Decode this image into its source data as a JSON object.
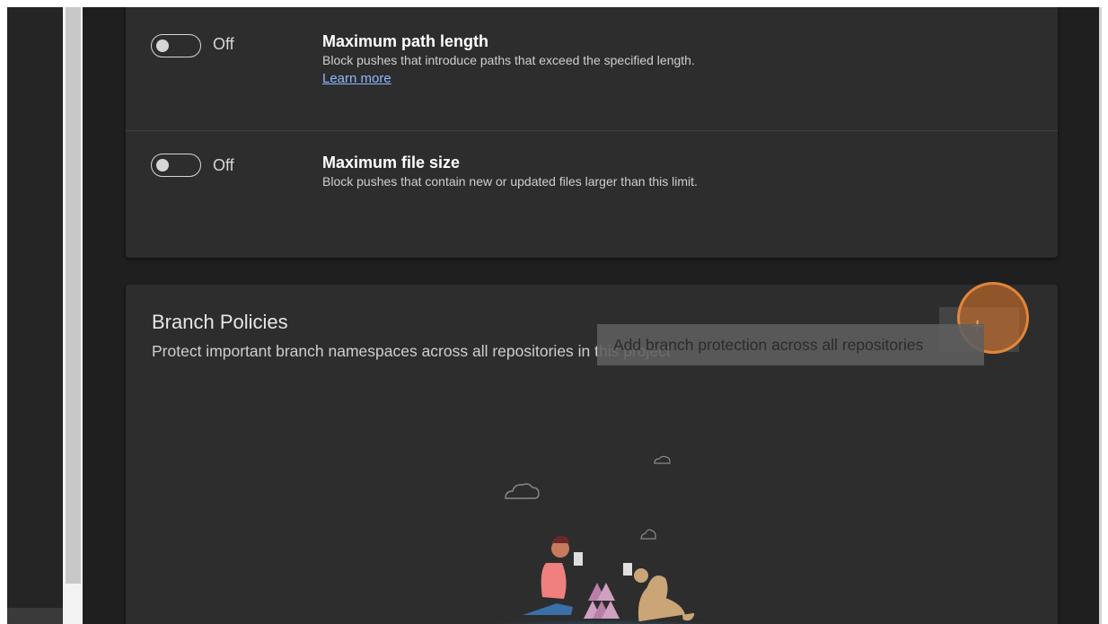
{
  "security_policies": [
    {
      "toggle_state": "Off",
      "title": "Maximum path length",
      "description": "Block pushes that introduce paths that exceed the specified length.",
      "link": "Learn more"
    },
    {
      "toggle_state": "Off",
      "title": "Maximum file size",
      "description": "Block pushes that contain new or updated files larger than this limit."
    }
  ],
  "branch_policies": {
    "title": "Branch Policies",
    "description": "Protect important branch namespaces across all repositories in this project",
    "add_button_icon": "+",
    "add_button_tooltip": "Add branch protection across all repositories"
  },
  "colors": {
    "page_background": "#1f1f1f",
    "card_background": "#2d2d2d",
    "link": "#8fb8ff",
    "click_highlight": "#e07828"
  }
}
